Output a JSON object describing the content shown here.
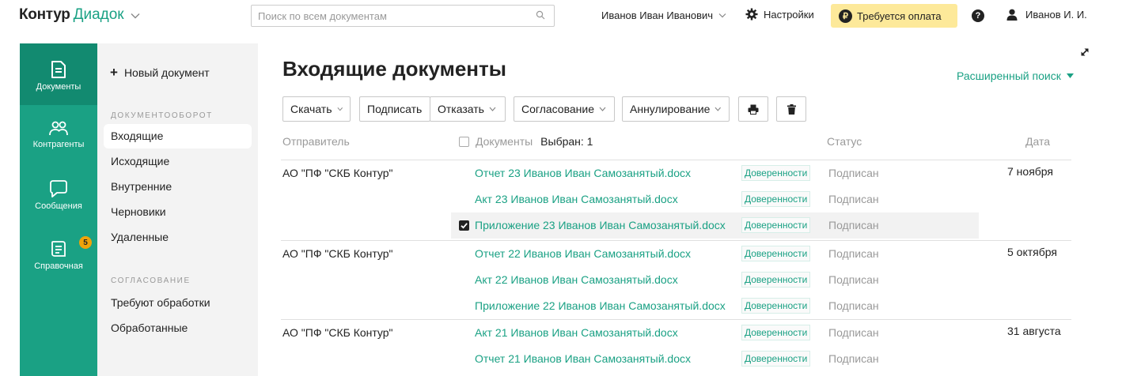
{
  "header": {
    "logo_brand": "Контур",
    "logo_product": "Диадок",
    "search_placeholder": "Поиск по всем документам",
    "user_name": "Иванов Иван Иванович",
    "settings_label": "Настройки",
    "payment_label": "Требуется оплата",
    "payment_icon_glyph": "₽",
    "help_glyph": "?",
    "account_name": "Иванов И. И."
  },
  "rail": {
    "items": [
      {
        "label": "Документы",
        "icon": "document-icon"
      },
      {
        "label": "Контрагенты",
        "icon": "people-icon"
      },
      {
        "label": "Сообщения",
        "icon": "chat-icon"
      },
      {
        "label": "Справочная",
        "icon": "book-icon",
        "badge": "5"
      }
    ]
  },
  "subnav": {
    "new_doc_label": "Новый документ",
    "new_doc_glyph": "+",
    "section_workflow": "ДОКУМЕНТООБОРОТ",
    "workflow_items": [
      "Входящие",
      "Исходящие",
      "Внутренние",
      "Черновики",
      "Удаленные"
    ],
    "section_approval": "СОГЛАСОВАНИЕ",
    "approval_items": [
      "Требуют обработки",
      "Обработанные"
    ]
  },
  "main": {
    "title": "Входящие документы",
    "advanced_search": "Расширенный поиск",
    "toolbar": {
      "download": "Скачать",
      "sign": "Подписать",
      "reject": "Отказать",
      "approval": "Согласование",
      "annul": "Аннулирование"
    },
    "columns": {
      "sender": "Отправитель",
      "documents": "Документы",
      "selected": "Выбран: 1",
      "status": "Статус",
      "date": "Дата"
    },
    "rows": [
      {
        "sender": "АО \"ПФ \"СКБ Контур\"",
        "doc": "Отчет 23 Иванов Иван Самозанятый.docx",
        "tag": "Доверенности",
        "status": "Подписан",
        "date": "7 ноября"
      },
      {
        "doc": "Акт 23 Иванов Иван Самозанятый.docx",
        "tag": "Доверенности",
        "status": "Подписан"
      },
      {
        "doc": "Приложение 23 Иванов Иван Самозанятый.docx",
        "tag": "Доверенности",
        "status": "Подписан",
        "checked": true
      },
      {
        "sender": "АО \"ПФ \"СКБ Контур\"",
        "doc": "Отчет 22 Иванов Иван Самозанятый.docx",
        "tag": "Доверенности",
        "status": "Подписан",
        "date": "5 октября"
      },
      {
        "doc": "Акт 22 Иванов Иван Самозанятый.docx",
        "tag": "Доверенности",
        "status": "Подписан"
      },
      {
        "doc": "Приложение 22 Иванов Иван Самозанятый.docx",
        "tag": "Доверенности",
        "status": "Подписан"
      },
      {
        "sender": "АО \"ПФ \"СКБ Контур\"",
        "doc": "Акт 21 Иванов Иван Самозанятый.docx",
        "tag": "Доверенности",
        "status": "Подписан",
        "date": "31 августа"
      },
      {
        "doc": "Отчет 21 Иванов Иван Самозанятый.docx",
        "tag": "Доверенности",
        "status": "Подписан"
      }
    ]
  },
  "colors": {
    "accent": "#1aa184",
    "rail_active": "#128a70",
    "payment_bg": "#fde99a",
    "badge": "#f0a30a"
  }
}
